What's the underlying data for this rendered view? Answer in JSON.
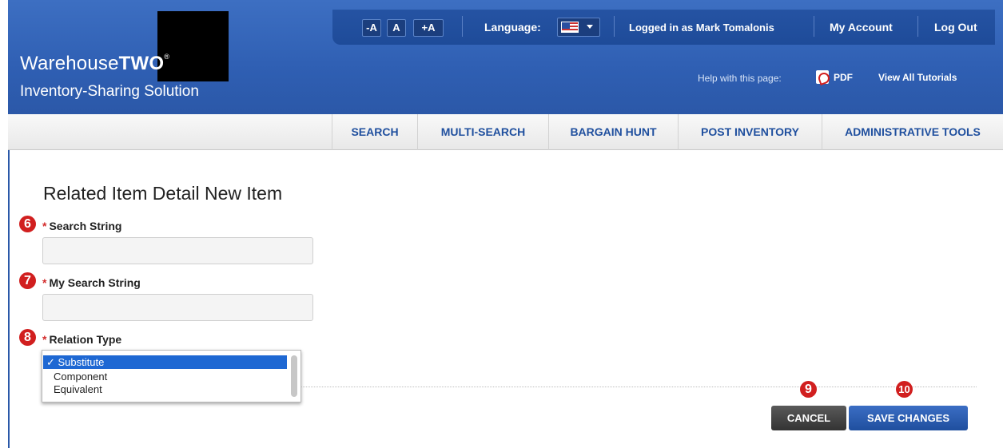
{
  "header": {
    "brand_light": "Warehouse",
    "brand_bold": "TWO",
    "brand_mark": "®",
    "tagline": "Inventory-Sharing Solution",
    "font_size_buttons": [
      "-A",
      "A",
      "+A"
    ],
    "language_label": "Language:",
    "language_flag_icon": "us-flag-icon",
    "logged_in_prefix": "Logged in as",
    "user_name": "Mark Tomalonis",
    "my_account": "My Account",
    "log_out": "Log Out",
    "help_label": "Help with this page:",
    "pdf_link": "PDF",
    "tutorials_link": "View All Tutorials"
  },
  "nav": {
    "items": [
      "SEARCH",
      "MULTI-SEARCH",
      "BARGAIN HUNT",
      "POST INVENTORY",
      "ADMINISTRATIVE TOOLS"
    ]
  },
  "main": {
    "title": "Related Item Detail New Item",
    "required_mark": "*",
    "fields": [
      {
        "callout": "6",
        "label": "Search String",
        "value": "",
        "placeholder": ""
      },
      {
        "callout": "7",
        "label": "My Search String",
        "value": "",
        "placeholder": ""
      },
      {
        "callout": "8",
        "label": "Relation Type"
      }
    ],
    "relation_options": [
      {
        "label": "✓ Substitute",
        "selected": true
      },
      {
        "label": "Component",
        "selected": false
      },
      {
        "label": "Equivalent",
        "selected": false
      }
    ],
    "buttons": {
      "cancel": "CANCEL",
      "cancel_callout": "9",
      "save": "SAVE CHANGES",
      "save_callout": "10"
    }
  },
  "colors": {
    "header_blue": "#2f5fb3",
    "nav_text": "#1f4f9e",
    "callout_red": "#d11f1f",
    "selected_option": "#1e68d3"
  }
}
